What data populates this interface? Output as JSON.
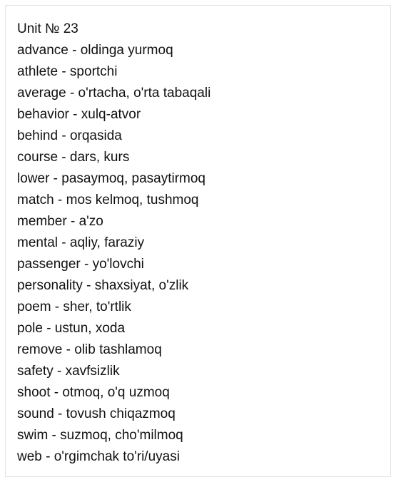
{
  "title": "Unit № 23",
  "entries": [
    "advance - oldinga yurmoq",
    "athlete - sportchi",
    "average - o'rtacha, o'rta tabaqali",
    "behavior - xulq-atvor",
    "behind - orqasida",
    "course - dars, kurs",
    "lower - pasaymoq, pasaytirmoq",
    "match - mos kelmoq, tushmoq",
    "member - a'zo",
    "mental - aqliy, faraziy",
    "passenger - yo'lovchi",
    "personality - shaxsiyat, o'zlik",
    "poem - sher, to'rtlik",
    "pole - ustun, xoda",
    "remove - olib tashlamoq",
    "safety - xavfsizlik",
    "shoot - otmoq, o'q uzmoq",
    "sound - tovush chiqazmoq",
    "swim - suzmoq, cho'milmoq",
    "web - o'rgimchak to'ri/uyasi"
  ]
}
